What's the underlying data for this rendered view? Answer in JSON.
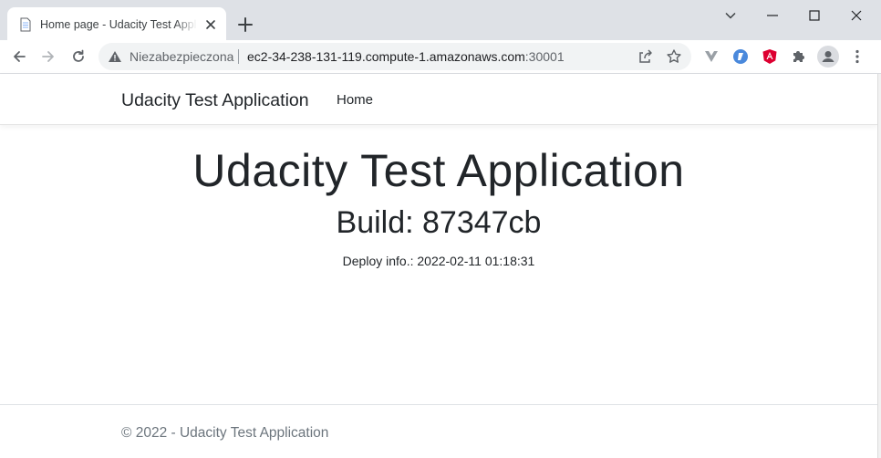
{
  "browser": {
    "tab": {
      "title": "Home page - Udacity Test Application"
    },
    "address_bar": {
      "security_label": "Niezabezpieczona",
      "host": "ec2-34-238-131-119.compute-1.amazonaws.com",
      "port": ":30001"
    }
  },
  "navbar": {
    "brand": "Udacity Test Application",
    "links": [
      "Home"
    ]
  },
  "main": {
    "title": "Udacity Test Application",
    "build": "Build: 87347cb",
    "deploy_info": "Deploy info.: 2022-02-11 01:18:31"
  },
  "footer": {
    "text": "© 2022 - Udacity Test Application"
  },
  "colors": {
    "tabstrip": "#dee1e6",
    "omnibox": "#f1f3f4",
    "text": "#212529",
    "footer_text": "#6c757d",
    "angular_red": "#dd0031",
    "lastpass_blue": "#4a89dc"
  }
}
